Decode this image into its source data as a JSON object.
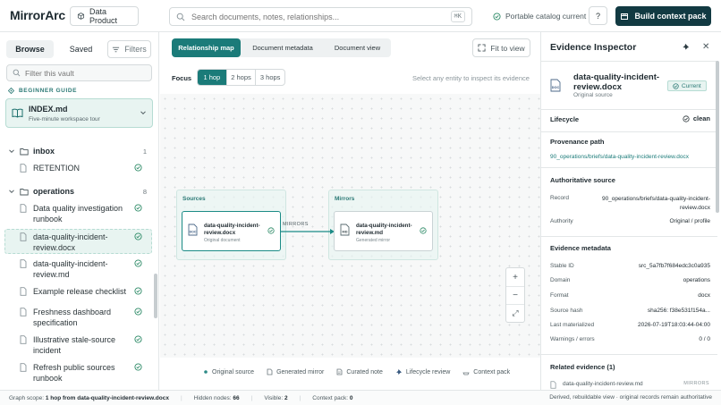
{
  "header": {
    "logo": "MirrorArc",
    "product_button": "Data Product",
    "search_placeholder": "Search documents, notes, relationships...",
    "search_shortcut": "⌘K",
    "catalog_status": "Portable catalog current",
    "help_label": "?",
    "build_button": "Build context pack"
  },
  "sidebar": {
    "tabs": {
      "browse": "Browse",
      "saved": "Saved",
      "filters": "Filters"
    },
    "filter_placeholder": "Filter this vault",
    "beginner_guide_label": "BEGINNER GUIDE",
    "guide": {
      "title": "INDEX.md",
      "subtitle": "Five-minute workspace tour"
    },
    "folders": [
      {
        "name": "inbox",
        "count": "1",
        "items": [
          "RETENTION"
        ]
      },
      {
        "name": "operations",
        "count": "8",
        "items": [
          "Data quality investigation runbook",
          "data-quality-incident-review.docx",
          "data-quality-incident-review.md",
          "Example release checklist",
          "Freshness dashboard specification",
          "Illustrative stale-source incident",
          "Refresh public sources runbook"
        ]
      }
    ]
  },
  "center": {
    "tabs": [
      "Relationship map",
      "Document metadata",
      "Document view"
    ],
    "fit_button": "Fit to view",
    "focus_label": "Focus",
    "hops": [
      "1 hop",
      "2 hops",
      "3 hops"
    ],
    "hint": "Select any entity to inspect its evidence",
    "graph": {
      "sources_label": "Sources",
      "mirrors_label": "Mirrors",
      "source_node": {
        "title": "data-quality-incident-review.docx",
        "sub": "Original document"
      },
      "mirror_node": {
        "title": "data-quality-incident-review.md",
        "sub": "Generated mirror"
      },
      "edge_label": "MIRRORS"
    },
    "zoom": {
      "in": "+",
      "out": "−",
      "expand": "⤢"
    },
    "legend": [
      "Original source",
      "Generated mirror",
      "Curated note",
      "Lifecycle review",
      "Context pack"
    ]
  },
  "inspector": {
    "title": "Evidence Inspector",
    "close": "✕",
    "doc_title": "data-quality-incident-review.docx",
    "doc_sub": "Original source",
    "badge": "Current",
    "lifecycle_label": "Lifecycle",
    "lifecycle_value": "clean",
    "provenance_label": "Provenance path",
    "provenance_path": "90_operations/briefs/data-quality-incident-review.docx",
    "authoritative_label": "Authoritative source",
    "record_key": "Record",
    "record_value": "90_operations/briefs/data-quality-incident-review.docx",
    "authority_key": "Authority",
    "authority_value": "Original / profile",
    "metadata_label": "Evidence metadata",
    "metadata": [
      {
        "key": "Stable ID",
        "value": "src_5a7fb7f684edc3c0a935"
      },
      {
        "key": "Domain",
        "value": "operations"
      },
      {
        "key": "Format",
        "value": "docx"
      },
      {
        "key": "Source hash",
        "value": "sha256: f38e531f154a..."
      },
      {
        "key": "Last materialized",
        "value": "2026-07-19T18:03:44-04:00"
      },
      {
        "key": "Warnings / errors",
        "value": "0 / 0"
      }
    ],
    "related_label": "Related evidence (1)",
    "related_item": "data-quality-incident-review.md",
    "related_tag": "MIRRORS"
  },
  "footer": {
    "graph_scope_label": "Graph scope:",
    "graph_scope_value": "1 hop from data-quality-incident-review.docx",
    "hidden_label": "Hidden nodes:",
    "hidden_value": "66",
    "visible_label": "Visible:",
    "visible_value": "2",
    "pack_label": "Context pack:",
    "pack_value": "0",
    "right_note": "Derived, rebuildable view · original records remain authoritative"
  }
}
